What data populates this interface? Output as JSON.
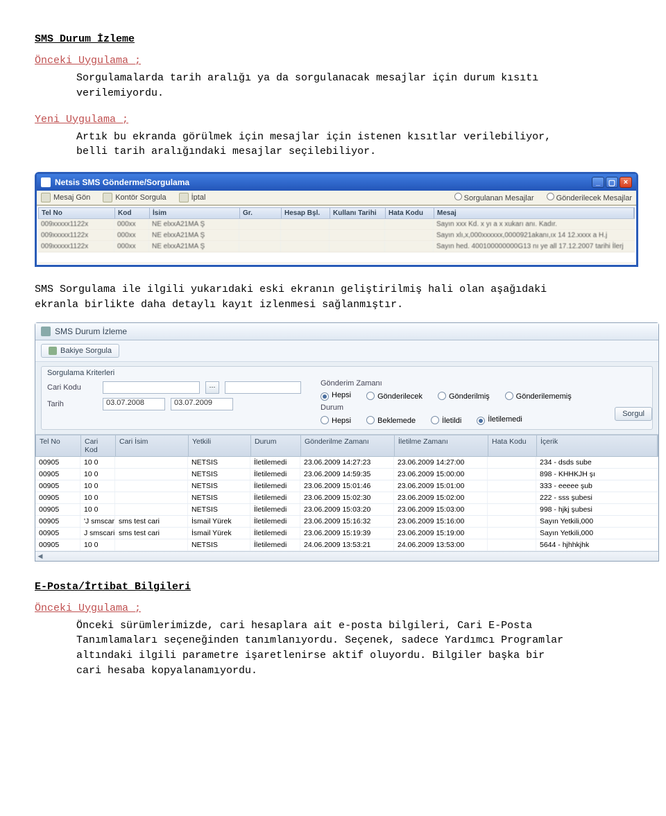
{
  "doc": {
    "h1": "SMS Durum İzleme",
    "prev_label": "Önceki Uygulama ;",
    "prev_text": "Sorgulamalarda tarih aralığı ya da sorgulanacak mesajlar için durum kısıtı verilemiyordu.",
    "new_label": "Yeni Uygulama ;",
    "new_text": "Artık bu ekranda görülmek için mesajlar için istenen kısıtlar verilebiliyor, belli tarih aralığındaki mesajlar seçilebiliyor.",
    "between_text": "SMS Sorgulama ile ilgili yukarıdaki eski ekranın geliştirilmiş hali olan aşağıdaki ekranla birlikte daha detaylı kayıt izlenmesi sağlanmıştır.",
    "h2": "E-Posta/İrtibat Bilgileri",
    "prev2_label": "Önceki Uygulama ;",
    "prev2_text": "Önceki sürümlerimizde, cari hesaplara ait e-posta bilgileri, Cari E-Posta Tanımlamaları seçeneğinden tanımlanıyordu. Seçenek, sadece Yardımcı Programlar altındaki ilgili parametre işaretlenirse aktif oluyordu. Bilgiler başka bir cari hesaba kopyalanamıyordu."
  },
  "app1": {
    "title": "Netsis SMS Gönderme/Sorgulama",
    "toolbar": [
      "Mesaj Gön",
      "Kontör Sorgula",
      "İptal"
    ],
    "radios": [
      "Sorgulanan Mesajlar",
      "Gönderilecek Mesajlar"
    ],
    "columns": [
      "Tel No",
      "Kod",
      "İsim",
      "Gr.",
      "Hesap Bşl.",
      "Kullanı Tarihi",
      "Hata Kodu",
      "Mesaj"
    ],
    "rows": [
      [
        "009xxxxx1122x",
        "000xx",
        "NE  elxxA21MA Ş",
        "",
        "",
        "",
        "",
        "Sayın xxx Kd. x yı a x xukarı anı. Kadır."
      ],
      [
        "009xxxxx1122x",
        "000xx",
        "NE  elxxA21MA Ş",
        "",
        "",
        "",
        "",
        "Sayın xlı,x,000xxxxxx,0000921akanı,ıx 14 12.xxxx  a     H.j"
      ],
      [
        "009xxxxx1122x",
        "000xx",
        "NE  elxxA21MA Ş",
        "",
        "",
        "",
        "",
        "Sayın hed. 400100000000G13  nı ye all 17.12.2007 tarihi İlerj"
      ]
    ]
  },
  "app2": {
    "title": "SMS Durum İzleme",
    "toolbar_button": "Bakiye Sorgula",
    "criteria_title": "Sorgulama Kriterleri",
    "cari_kodu_label": "Cari Kodu",
    "tarih_label": "Tarih",
    "tarih_from": "03.07.2008",
    "tarih_to": "03.07.2009",
    "gonderim_label": "Gönderim Zamanı",
    "gonderim_opts": [
      "Hepsi",
      "Gönderilecek",
      "Gönderilmiş",
      "Gönderilememiş"
    ],
    "gonderim_selected": 0,
    "durum_label": "Durum",
    "durum_opts": [
      "Hepsi",
      "Beklemede",
      "İletildi",
      "İletilemedi"
    ],
    "durum_selected": 3,
    "sorgula_btn": "Sorgul",
    "columns": [
      "Tel No",
      "Cari Kod",
      "Cari İsim",
      "Yetkili",
      "Durum",
      "Gönderilme Zamanı",
      "İletilme Zamanı",
      "Hata Kodu",
      "İçerik"
    ],
    "rows": [
      [
        "00905",
        "10  0",
        "",
        "NETSIS",
        "İletilemedi",
        "23.06.2009 14:27:23",
        "23.06.2009 14:27:00",
        "",
        "234 - dsds sube"
      ],
      [
        "00905",
        "10  0",
        "",
        "NETSIS",
        "İletilemedi",
        "23.06.2009 14:59:35",
        "23.06.2009 15:00:00",
        "",
        "898 - KHHKJH şı"
      ],
      [
        "00905",
        "10  0",
        "",
        "NETSIS",
        "İletilemedi",
        "23.06.2009 15:01:46",
        "23.06.2009 15:01:00",
        "",
        "333 - eeeee şub"
      ],
      [
        "00905",
        "10  0",
        "",
        "NETSIS",
        "İletilemedi",
        "23.06.2009 15:02:30",
        "23.06.2009 15:02:00",
        "",
        "222 - sss şubesi"
      ],
      [
        "00905",
        "10  0",
        "",
        "NETSIS",
        "İletilemedi",
        "23.06.2009 15:03:20",
        "23.06.2009 15:03:00",
        "",
        "998 - hjkj şubesi"
      ],
      [
        "00905",
        "'J  smscari",
        "sms test cari",
        "İsmail Yürek",
        "İletilemedi",
        "23.06.2009 15:16:32",
        "23.06.2009 15:16:00",
        "",
        "Sayın Yetkili,000"
      ],
      [
        "00905",
        "J  smscari",
        "sms test cari",
        "İsmail Yürek",
        "İletilemedi",
        "23.06.2009 15:19:39",
        "23.06.2009 15:19:00",
        "",
        "Sayın Yetkili,000"
      ],
      [
        "00905",
        "10  0",
        "",
        "NETSIS",
        "İletilemedi",
        "24.06.2009 13:53:21",
        "24.06.2009 13:53:00",
        "",
        "5644 - hjhhkjhk"
      ]
    ]
  }
}
